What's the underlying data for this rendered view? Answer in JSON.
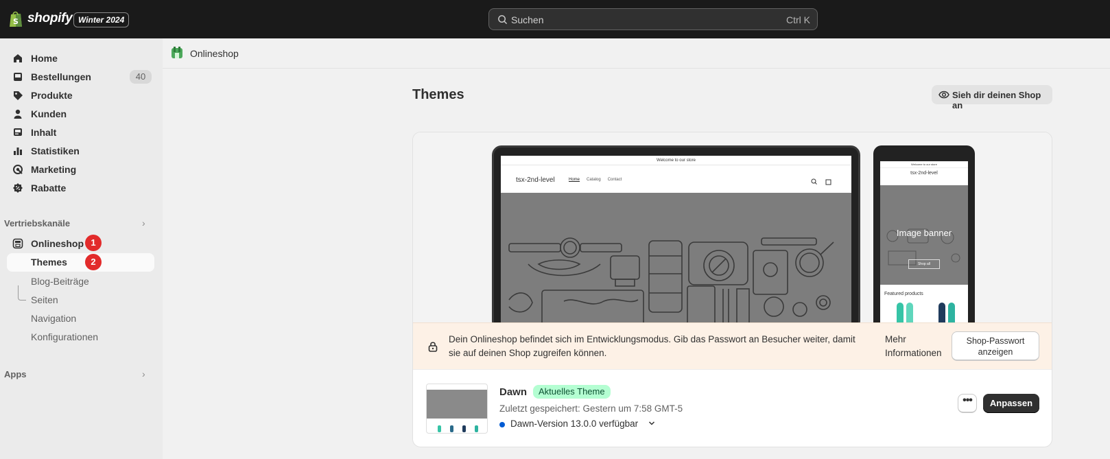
{
  "topbar": {
    "logo_text": "shopify",
    "edition": "Winter 2024",
    "search_placeholder": "Suchen",
    "search_shortcut": "Ctrl K"
  },
  "sidebar": {
    "items": [
      {
        "label": "Home",
        "icon": "home-icon"
      },
      {
        "label": "Bestellungen",
        "icon": "orders-icon",
        "count": "40"
      },
      {
        "label": "Produkte",
        "icon": "tag-icon"
      },
      {
        "label": "Kunden",
        "icon": "person-icon"
      },
      {
        "label": "Inhalt",
        "icon": "content-icon"
      },
      {
        "label": "Statistiken",
        "icon": "chart-icon"
      },
      {
        "label": "Marketing",
        "icon": "target-icon"
      },
      {
        "label": "Rabatte",
        "icon": "discount-icon"
      }
    ],
    "sales_channels_heading": "Vertriebskanäle",
    "onlineshop_label": "Onlineshop",
    "onlineshop_step": "1",
    "sub_items": [
      "Themes",
      "Blog-Beiträge",
      "Seiten",
      "Navigation",
      "Konfigurationen"
    ],
    "themes_step": "2",
    "apps_heading": "Apps"
  },
  "breadcrumb": {
    "label": "Onlineshop"
  },
  "page": {
    "title": "Themes",
    "view_shop_label": "Sieh dir deinen Shop an"
  },
  "preview": {
    "announcement": "Welcome to our store",
    "store_name": "tsx-2nd-level",
    "nav": [
      "Home",
      "Catalog",
      "Contact"
    ],
    "mobile_banner_title": "Image banner",
    "mobile_shop_button": "Shop all",
    "mobile_featured": "Featured products"
  },
  "dev_banner": {
    "text": "Dein Onlineshop befindet sich im Entwicklungsmodus. Gib das Passwort an Besucher weiter, damit sie auf deinen Shop zugreifen können.",
    "more_info": "Mehr Informationen",
    "password_button": "Shop-Passwort anzeigen"
  },
  "theme": {
    "name": "Dawn",
    "badge": "Aktuelles Theme",
    "saved": "Zuletzt gespeichert: Gestern um 7:58 GMT-5",
    "version": "Dawn-Version 13.0.0 verfügbar",
    "more_actions": "•••",
    "customize_label": "Anpassen"
  },
  "colors": {
    "topbar": "#1a1a1a",
    "step_badge": "#e22b2b",
    "theme_badge_bg": "#b4fed2",
    "version_dot": "#005bd3",
    "primary_button": "#303030"
  }
}
